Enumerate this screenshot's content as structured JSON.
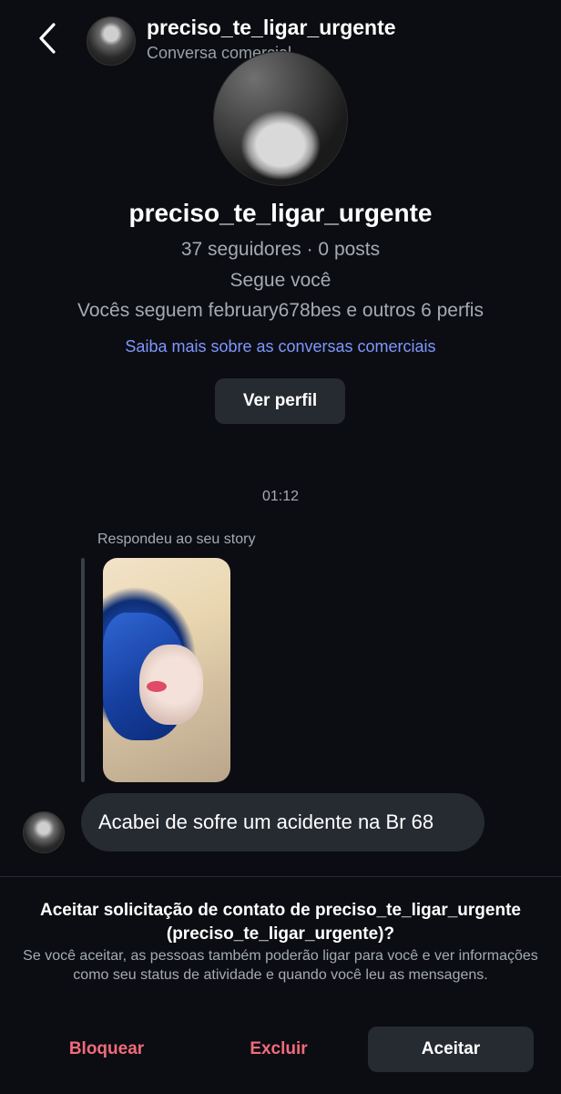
{
  "header": {
    "name": "preciso_te_ligar_urgente",
    "subtitle": "Conversa comercial",
    "back_icon": "chevron-left-icon"
  },
  "profile": {
    "name": "preciso_te_ligar_urgente",
    "stats": "37 seguidores · 0 posts",
    "follows_you": "Segue você",
    "mutual": "Vocês seguem february678bes e outros 6 perfis",
    "info_link": "Saiba mais sobre as conversas comerciais",
    "view_profile_label": "Ver perfil"
  },
  "conversation": {
    "timestamp": "01:12",
    "story_caption": "Respondeu ao seu story",
    "message": "Acabei de sofre um acidente na Br 68"
  },
  "request": {
    "title": "Aceitar solicitação de contato de preciso_te_ligar_urgente (preciso_te_ligar_urgente)?",
    "description": "Se você aceitar, as pessoas também poderão ligar para você e ver informações como seu status de atividade e quando você leu as mensagens.",
    "block_label": "Bloquear",
    "delete_label": "Excluir",
    "accept_label": "Aceitar"
  },
  "colors": {
    "background": "#0b0d12",
    "link": "#7f97ff",
    "danger": "#f26b7a",
    "button_bg": "#262a31"
  }
}
